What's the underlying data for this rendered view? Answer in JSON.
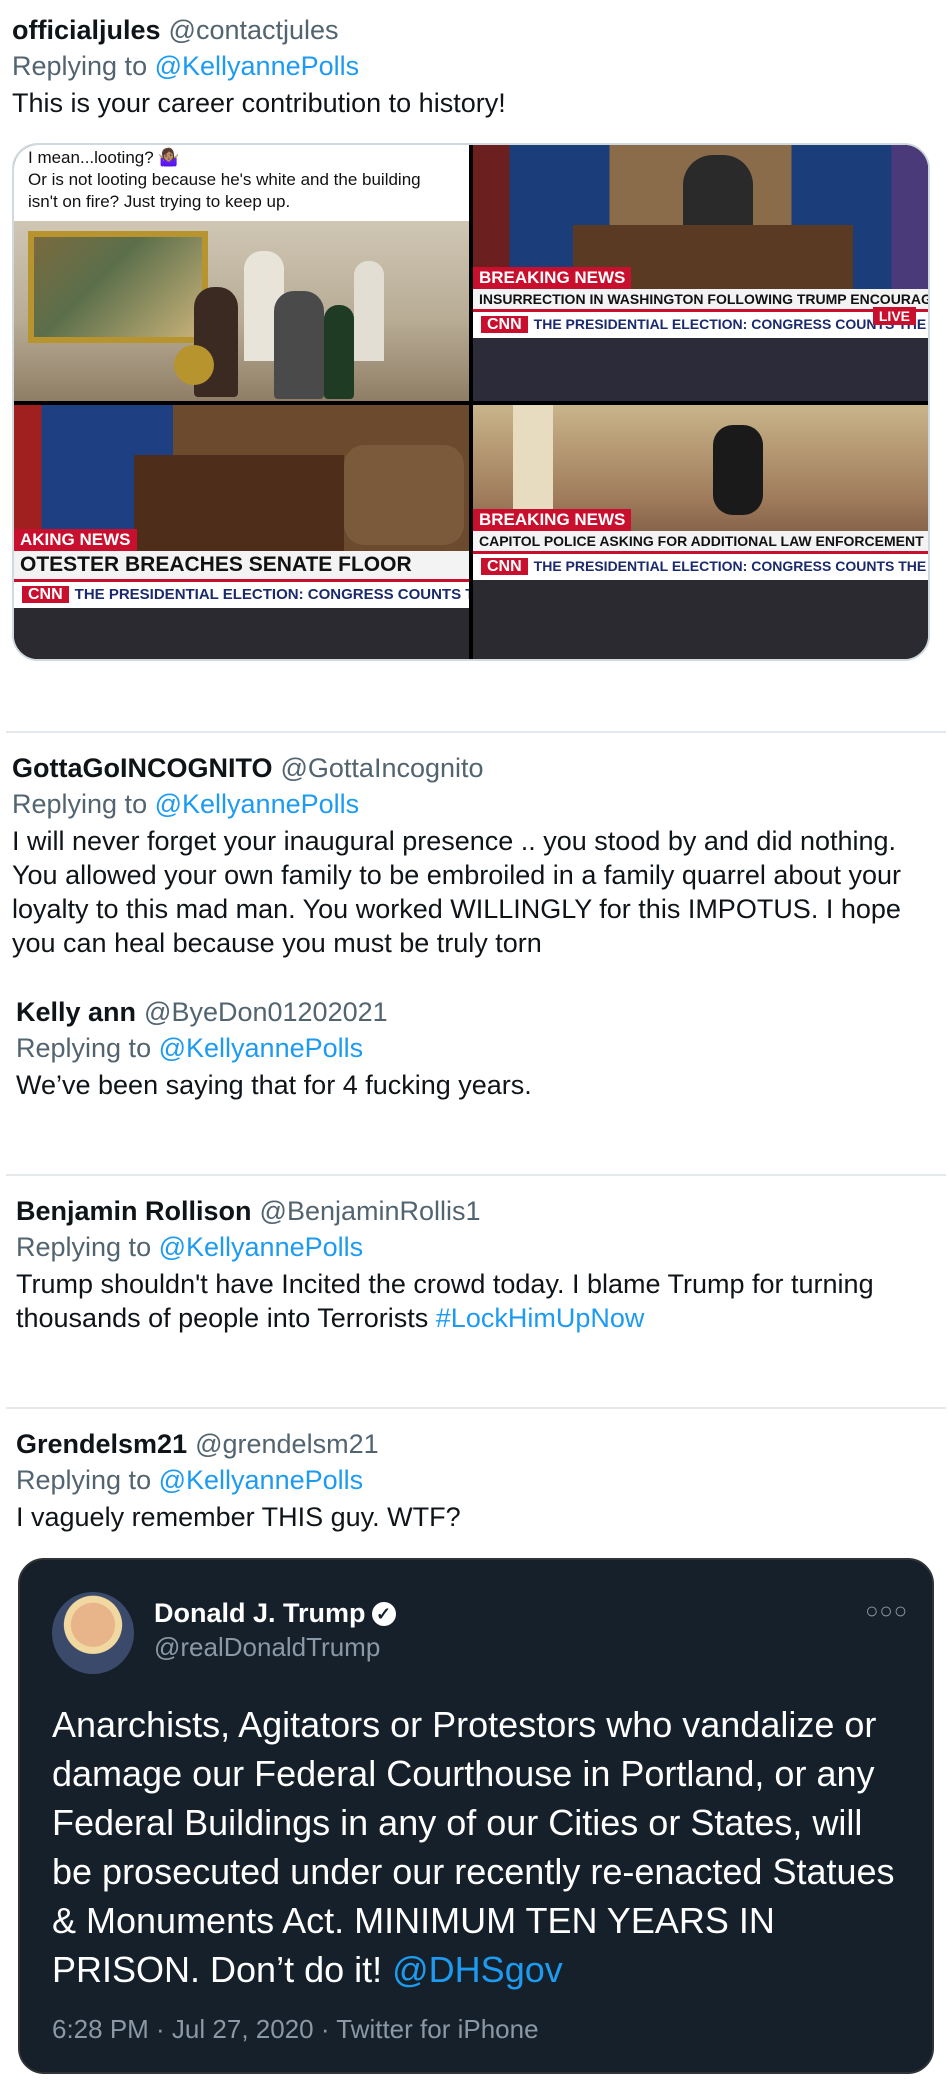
{
  "tweets": [
    {
      "name": "officialjules",
      "handle": "@contactjules",
      "replying_prefix": "Replying to",
      "replying_to": "@KellyannePolls",
      "text": "This is your career contribution to history!",
      "media": {
        "caption_line1": "I mean...looting? 🤷🏽‍♀️",
        "caption_line2": "Or is not looting because he's white and the building",
        "caption_line3": "isn't on fire? Just trying to keep up.",
        "cell2": {
          "breaking": "BREAKING NEWS",
          "headline": "INSURRECTION IN WASHINGTON FOLLOWING TRUMP ENCOURAGEMENT",
          "logo": "CNN",
          "bar": "THE PRESIDENTIAL ELECTION: CONGRESS COUNTS THE VOTE",
          "live": "LIVE"
        },
        "cell3": {
          "breaking": "AKING NEWS",
          "headline": "OTESTER BREACHES SENATE FLOOR",
          "logo": "CNN",
          "bar": "THE PRESIDENTIAL ELECTION: CONGRESS COUNTS THE VOTE"
        },
        "cell4": {
          "breaking": "BREAKING NEWS",
          "headline": "CAPITOL POLICE ASKING FOR ADDITIONAL LAW ENFORCEMENT HELP",
          "logo": "CNN",
          "bar": "THE PRESIDENTIAL ELECTION: CONGRESS COUNTS THE VOTE"
        }
      }
    },
    {
      "name": "GottaGoINCOGNITO",
      "handle": "@GottaIncognito",
      "replying_prefix": "Replying to",
      "replying_to": "@KellyannePolls",
      "text": "I will never forget your inaugural presence .. you stood by and did nothing. You allowed your own family to be embroiled in a family quarrel about your loyalty to this mad man. You worked WILLINGLY for this IMPOTUS. I hope you can heal because you must be truly torn"
    },
    {
      "name": "Kelly ann",
      "handle": "@ByeDon01202021",
      "replying_prefix": "Replying to",
      "replying_to": "@KellyannePolls",
      "text": "We’ve been saying that for 4 fucking years."
    },
    {
      "name": "Benjamin Rollison",
      "handle": "@BenjaminRollis1",
      "replying_prefix": "Replying to",
      "replying_to": "@KellyannePolls",
      "text": "Trump shouldn't have Incited the crowd today. I blame Trump for turning thousands of people into Terrorists",
      "hashtag": "#LockHimUpNow"
    },
    {
      "name": "Grendelsm21",
      "handle": "@grendelsm21",
      "replying_prefix": "Replying to",
      "replying_to": "@KellyannePolls",
      "text": "I vaguely remember THIS guy.  WTF?",
      "embedded": {
        "name": "Donald J. Trump",
        "handle": "@realDonaldTrump",
        "text": "Anarchists, Agitators or Protestors who vandalize or damage our Federal Courthouse in Portland, or any Federal Buildings in any of our Cities or States, will be prosecuted under our recently re-enacted Statues & Monuments Act. MINIMUM TEN YEARS IN PRISON. Don’t do it!",
        "mention": "@DHSgov",
        "meta": "6:28 PM · Jul 27, 2020 · Twitter for iPhone"
      }
    }
  ],
  "colors": {
    "link": "#1d9bf0",
    "muted": "#536471",
    "dark_bg": "#15202b",
    "cnn_red": "#c8102e"
  }
}
